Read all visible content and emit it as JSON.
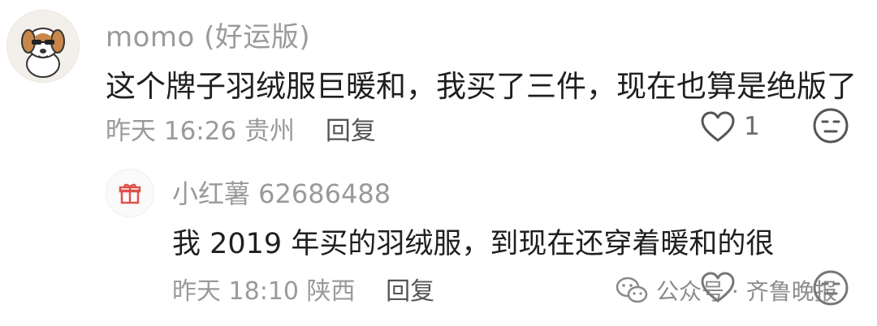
{
  "comment": {
    "username": "momo (好运版)",
    "text": "这个牌子羽绒服巨暖和，我买了三件，现在也算是绝版了",
    "time": "昨天 16:26",
    "location": "贵州",
    "reply_label": "回复",
    "like_count": "1"
  },
  "reply": {
    "username": "小红薯 62686488",
    "text": "我 2019 年买的羽绒服，到现在还穿着暖和的很",
    "time": "昨天 18:10",
    "location": "陕西",
    "reply_label": "回复"
  },
  "watermark": {
    "text": "公众号 · 齐鲁晚报"
  },
  "colors": {
    "text_primary": "#1f1f1f",
    "text_secondary": "#9a9a9a",
    "gift_red": "#e0504a"
  },
  "icons": {
    "avatar_main": "dog-cartoon-avatar",
    "avatar_reply": "gift-icon",
    "like": "heart-outline-icon",
    "reaction": "neutral-face-icon",
    "watermark": "wechat-icon"
  }
}
